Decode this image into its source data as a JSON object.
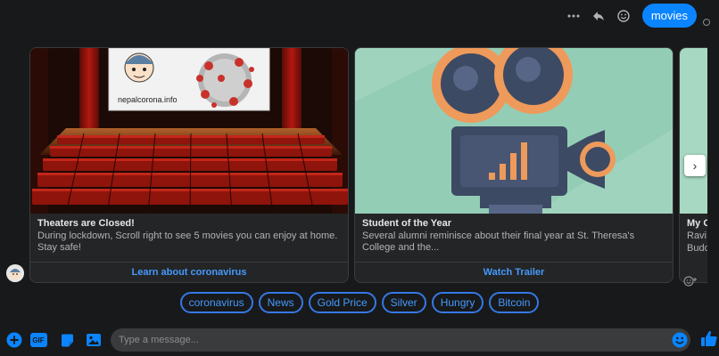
{
  "sent_message": "movies",
  "top_icons": [
    "more-icon",
    "reply-icon",
    "emoji-icon"
  ],
  "cards": [
    {
      "title": "Theaters are Closed!",
      "subtitle": "During lockdown, Scroll right to see 5 movies you can enjoy at home. Stay safe!",
      "button": "Learn about coronavirus",
      "image_caption": "nepalcorona.info"
    },
    {
      "title": "Student of the Year",
      "subtitle": "Several alumni reminisce about their final year at St. Theresa's College and the...",
      "button": "Watch Trailer"
    },
    {
      "title": "My C",
      "subtitle_line1": "Ravi",
      "subtitle_line2": "Budd"
    }
  ],
  "quick_replies": [
    "coronavirus",
    "News",
    "Gold Price",
    "Silver",
    "Hungry",
    "Bitcoin"
  ],
  "composer": {
    "placeholder": "Type a message...",
    "gif_label": "GIF"
  },
  "colors": {
    "accent": "#0a84ff",
    "link": "#4599ff",
    "background": "#18191a",
    "card": "#242526"
  }
}
